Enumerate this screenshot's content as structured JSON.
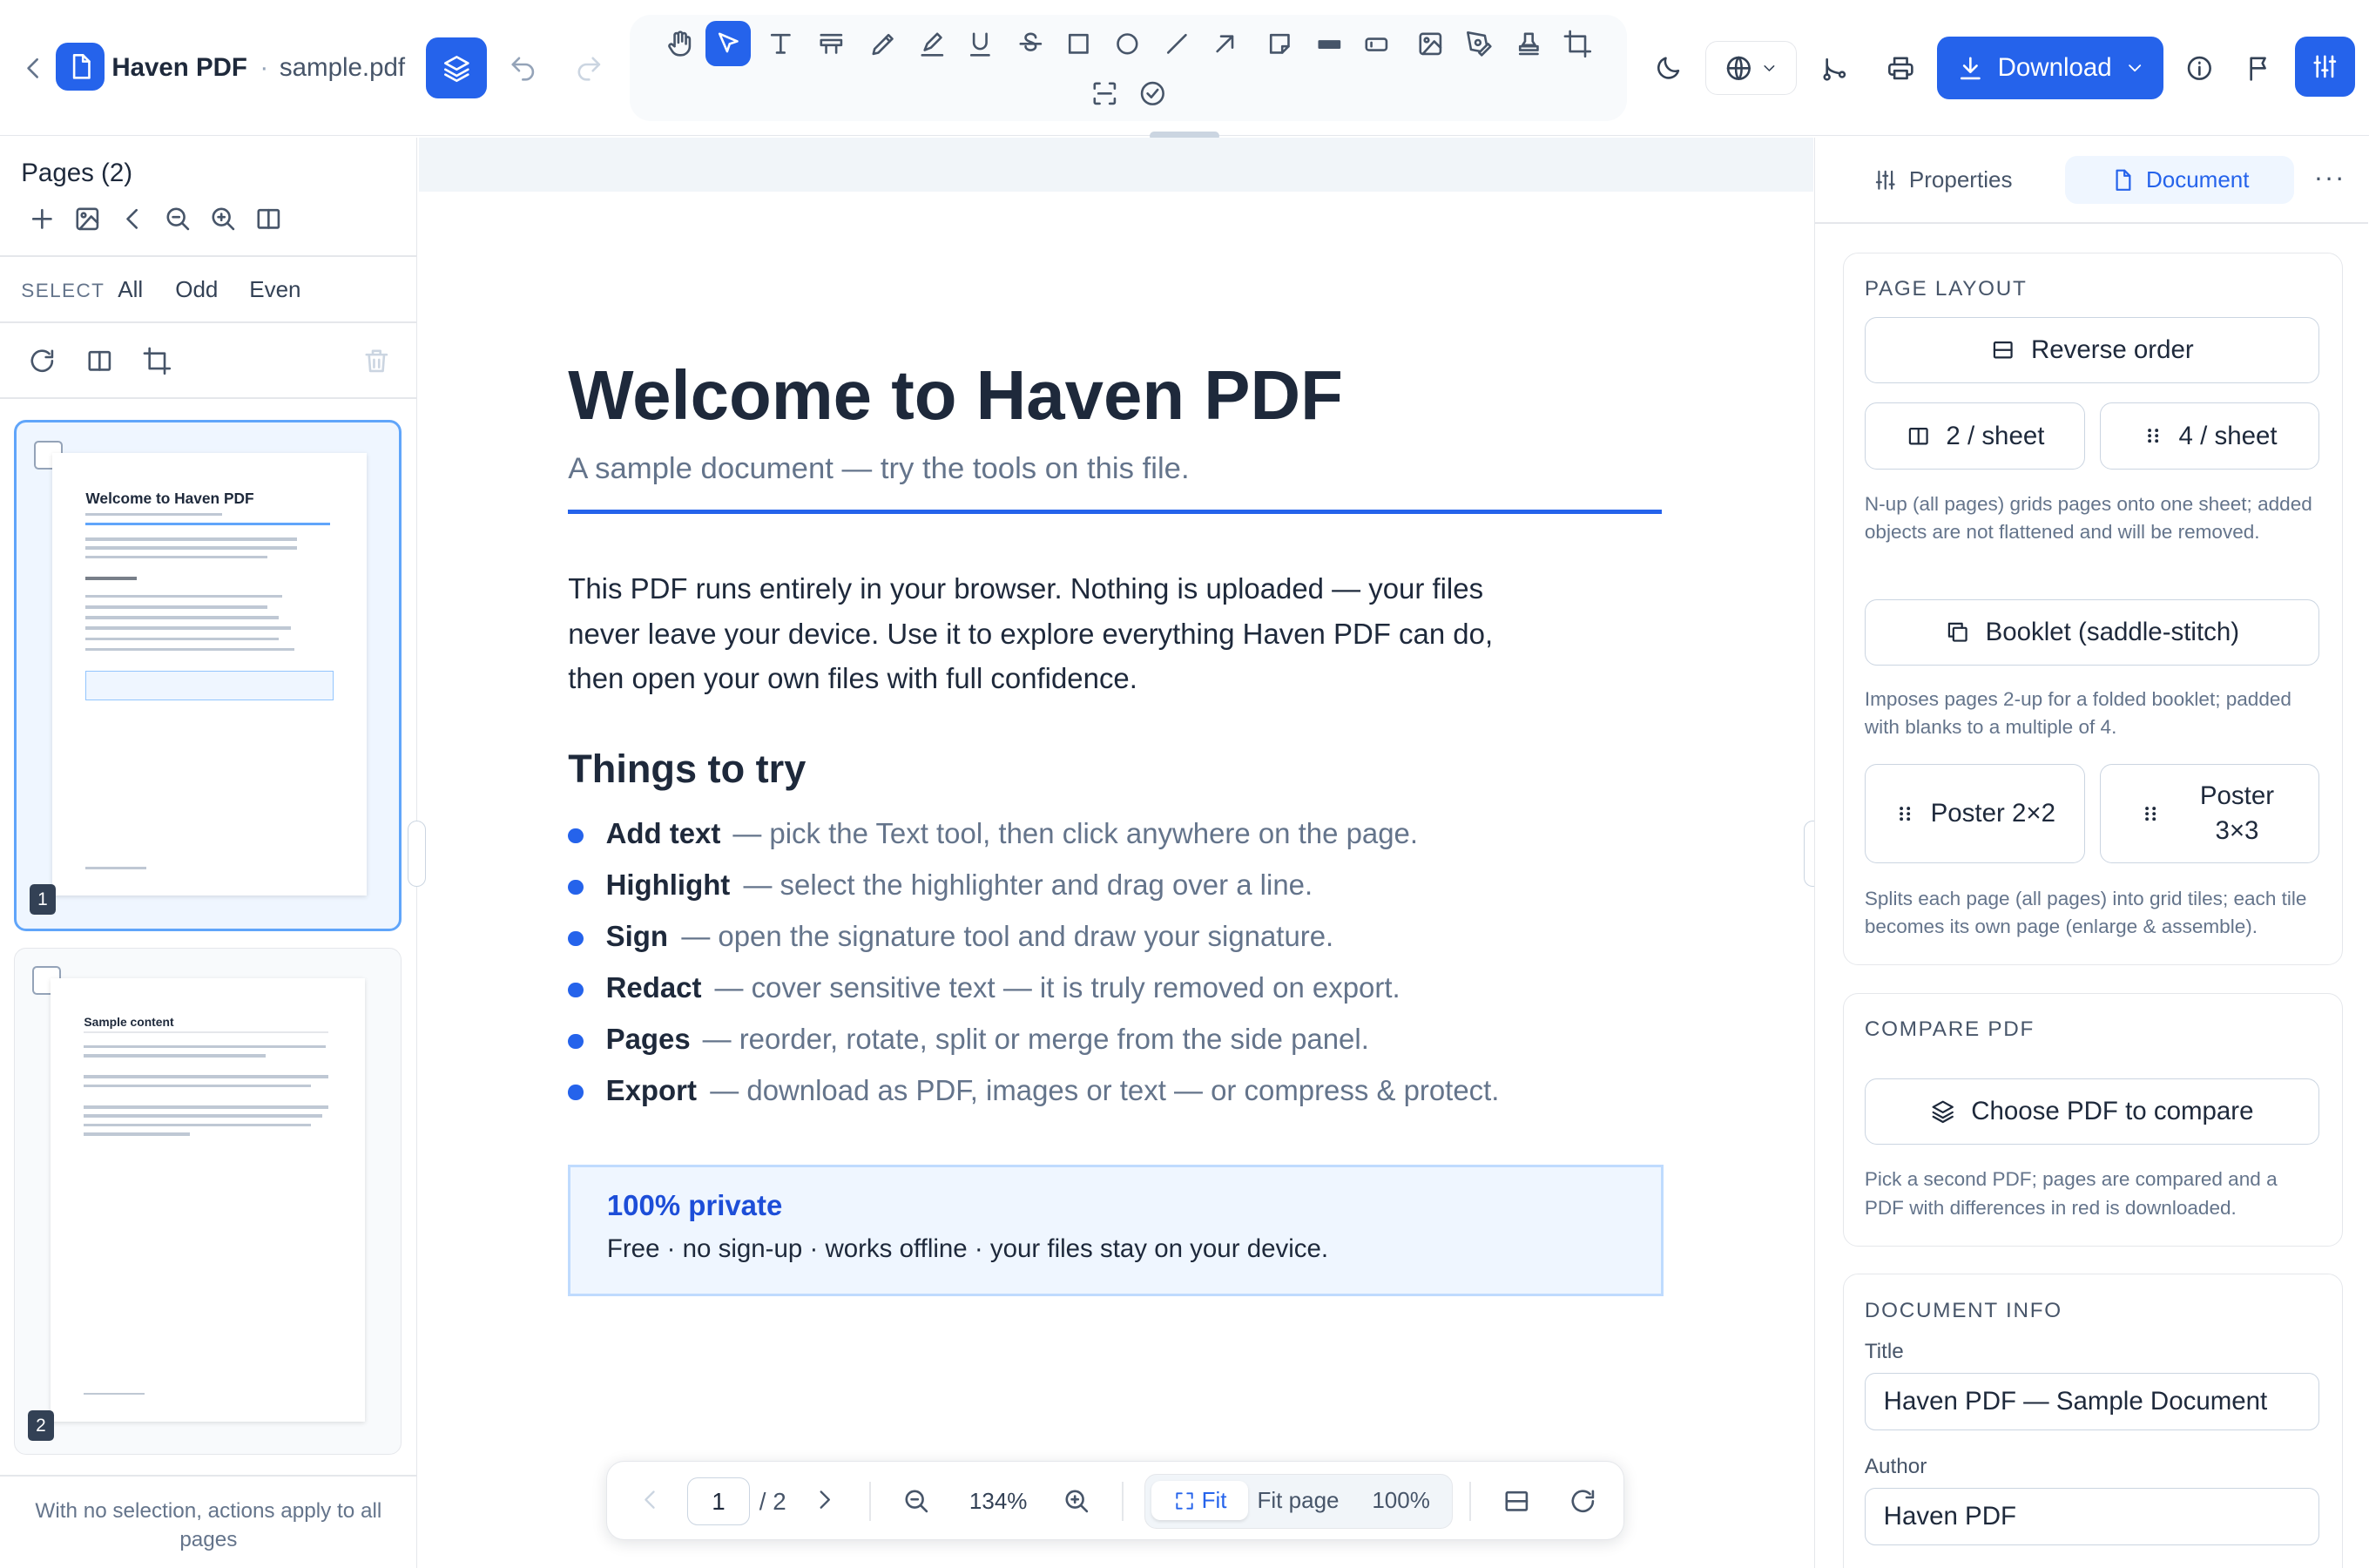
{
  "topbar": {
    "app_name": "Haven PDF",
    "separator": "·",
    "file_name": "sample.pdf",
    "download_label": "Download",
    "tools": [
      "pan-icon",
      "select-icon",
      "text-icon",
      "highlight-icon",
      "pen-icon",
      "marker-icon",
      "underline-icon",
      "strikethrough-icon",
      "rectangle-icon",
      "ellipse-icon",
      "line-icon",
      "arrow-icon",
      "note-icon",
      "redact-icon",
      "field-icon",
      "image-icon",
      "signature-icon",
      "stamp-icon",
      "crop-icon",
      "ocr-icon",
      "check-icon"
    ],
    "active_tool": "select-icon",
    "brand_color": "#2563eb"
  },
  "left_panel": {
    "title": "Pages (2)",
    "select_label": "SELECT",
    "select_options": [
      "All",
      "Odd",
      "Even"
    ],
    "footer": "With no selection, actions apply to all pages",
    "thumbnails": [
      {
        "number": "1",
        "heading": "Welcome to Haven PDF",
        "selected": true
      },
      {
        "number": "2",
        "heading": "Sample content",
        "selected": false
      }
    ]
  },
  "document": {
    "title": "Welcome to Haven PDF",
    "subtitle": "A sample document — try the tools on this file.",
    "paragraph": "This PDF runs entirely in your browser. Nothing is uploaded — your files never leave your device. Use it to explore everything Haven PDF can do, then open your own files with full confidence.",
    "section_title": "Things to try",
    "items": [
      {
        "term": "Add text",
        "desc": "— pick the Text tool, then click anywhere on the page."
      },
      {
        "term": "Highlight",
        "desc": "— select the highlighter and drag over a line."
      },
      {
        "term": "Sign",
        "desc": "— open the signature tool and draw your signature."
      },
      {
        "term": "Redact",
        "desc": "— cover sensitive text — it is truly removed on export."
      },
      {
        "term": "Pages",
        "desc": "— reorder, rotate, split or merge from the side panel."
      },
      {
        "term": "Export",
        "desc": "— download as PDF, images or text — or compress & protect."
      }
    ],
    "callout_title": "100% private",
    "callout_body": "Free · no sign-up · works offline · your files stay on your device."
  },
  "navigator": {
    "page_current": "1",
    "page_total": "/ 2",
    "zoom": "134%",
    "fit_label": "Fit",
    "fit_page_label": "Fit page",
    "actual_size_label": "100%"
  },
  "right_panel": {
    "tabs": [
      "Properties",
      "Document"
    ],
    "active_tab": "Document",
    "more": "···",
    "page_layout": {
      "heading": "PAGE LAYOUT",
      "reverse_label": "Reverse order",
      "two_sheet_label": "2 / sheet",
      "four_sheet_label": "4 / sheet",
      "nup_note": "N-up (all pages) grids pages onto one sheet; added objects are not flattened and will be removed.",
      "booklet_label": "Booklet (saddle-stitch)",
      "booklet_note": "Imposes pages 2-up for a folded booklet; padded with blanks to a multiple of 4.",
      "poster2_label": "Poster 2×2",
      "poster3_label": "Poster 3×3",
      "poster_note": "Splits each page (all pages) into grid tiles; each tile becomes its own page (enlarge & assemble)."
    },
    "compare": {
      "heading": "COMPARE PDF",
      "button_label": "Choose PDF to compare",
      "note": "Pick a second PDF; pages are compared and a PDF with differences in red is downloaded."
    },
    "doc_info": {
      "heading": "DOCUMENT INFO",
      "title_label": "Title",
      "title_value": "Haven PDF — Sample Document",
      "author_label": "Author",
      "author_value": "Haven PDF"
    }
  }
}
